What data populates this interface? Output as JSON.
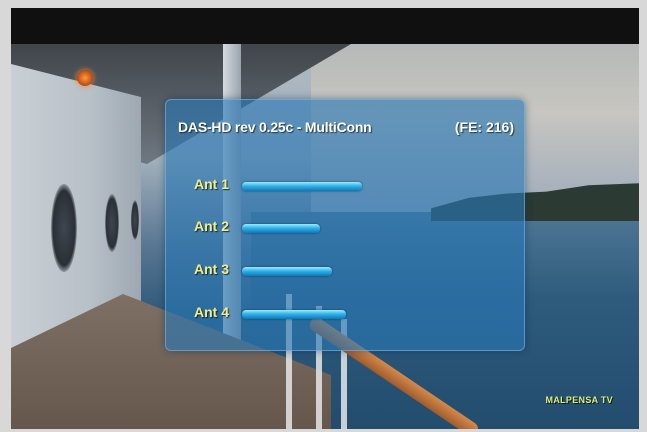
{
  "osd": {
    "title": "DAS-HD rev 0.25c - MultiConn",
    "fe": "(FE: 216)",
    "antennas": [
      {
        "label": "Ant 1",
        "level": 0.52
      },
      {
        "label": "Ant 2",
        "level": 0.34
      },
      {
        "label": "Ant 3",
        "level": 0.39
      },
      {
        "label": "Ant 4",
        "level": 0.45
      }
    ]
  },
  "watermark": "MALPENSA TV",
  "colors": {
    "panel": "#2878b4",
    "label": "#f1ef8a",
    "bar": "#2fb3e8"
  }
}
